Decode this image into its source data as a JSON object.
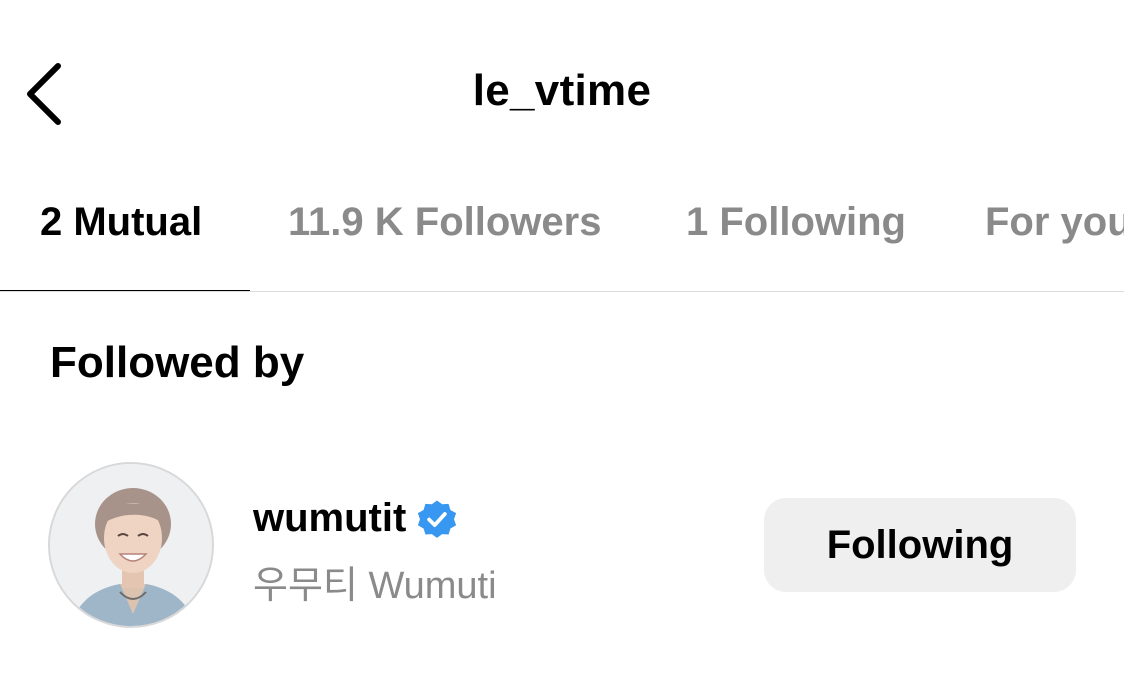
{
  "header": {
    "back_icon": "chevron-left-icon",
    "title": "le_vtime"
  },
  "tabs": [
    {
      "label": "2 Mutual",
      "active": true
    },
    {
      "label": "11.9 K Followers",
      "active": false
    },
    {
      "label": "1 Following",
      "active": false
    },
    {
      "label": "For you",
      "active": false
    }
  ],
  "section": {
    "title": "Followed by"
  },
  "users": [
    {
      "username": "wumutit",
      "verified": true,
      "verified_icon": "verified-badge-icon",
      "full_name": "우무티 Wumuti",
      "button_label": "Following"
    }
  ],
  "colors": {
    "text_primary": "#000000",
    "text_secondary": "#8a8a8a",
    "verified_blue": "#3897f0",
    "button_bg": "#efefef",
    "divider": "#dcdcdc"
  }
}
